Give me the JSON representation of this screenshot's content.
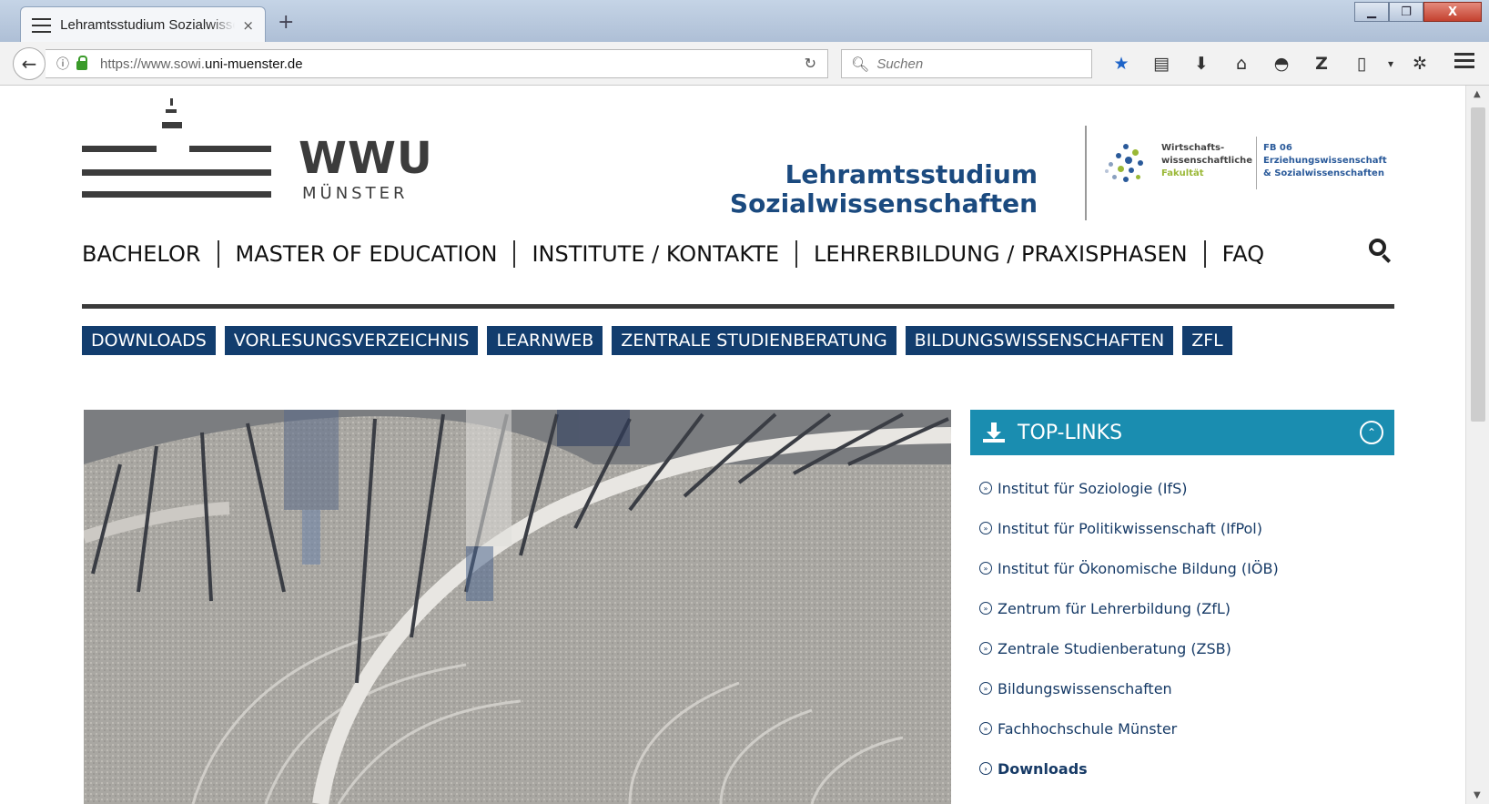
{
  "browser": {
    "tab_title": "Lehramtsstudium Sozialwisse",
    "tab_close": "×",
    "new_tab": "+",
    "url_prefix": "https://www.sowi.",
    "url_domain": "uni-muenster.de",
    "search_placeholder": "Suchen",
    "window_buttons": {
      "minimize": "▁",
      "maximize": "❐",
      "close": "X"
    },
    "toolbar_icons": [
      "star-icon",
      "reading-list-icon",
      "download-icon",
      "home-icon",
      "pocket-icon",
      "zotero-icon",
      "page-icon",
      "dropdown-icon",
      "extension-icon",
      "menu-icon"
    ]
  },
  "header": {
    "logo_main": "WWU",
    "logo_sub": "MÜNSTER",
    "site_title_line1": "Lehramtsstudium",
    "site_title_line2": "Sozialwissenschaften",
    "faculty_line1": "Wirtschafts-",
    "faculty_line2": "wissenschaftliche",
    "faculty_line3": "Fakultät",
    "fb_line1": "FB 06",
    "fb_line2": "Erziehungswissenschaft",
    "fb_line3": "& Sozialwissenschaften"
  },
  "main_nav": [
    "BACHELOR",
    "MASTER OF EDUCATION",
    "INSTITUTE / KONTAKTE",
    "LEHRERBILDUNG / PRAXISPHASEN",
    "FAQ"
  ],
  "quick_links": [
    "DOWNLOADS",
    "VORLESUNGSVERZEICHNIS",
    "LEARNWEB",
    "ZENTRALE STUDIENBERATUNG",
    "BILDUNGSWISSENSCHAFTEN",
    "ZFL"
  ],
  "top_links": {
    "title": "TOP-LINKS",
    "items": [
      "Institut für Soziologie (IfS)",
      "Institut für Politikwissenschaft (IfPol)",
      "Institut für Ökonomische Bildung (IÖB)",
      "Zentrum für Lehrerbildung (ZfL)",
      "Zentrale Studienberatung (ZSB)",
      "Bildungswissenschaften",
      "Fachhochschule Münster",
      "Downloads"
    ]
  },
  "colors": {
    "nav_blue": "#123d6e",
    "panel_teal": "#1a8db0",
    "title_blue": "#1b4a7f"
  }
}
